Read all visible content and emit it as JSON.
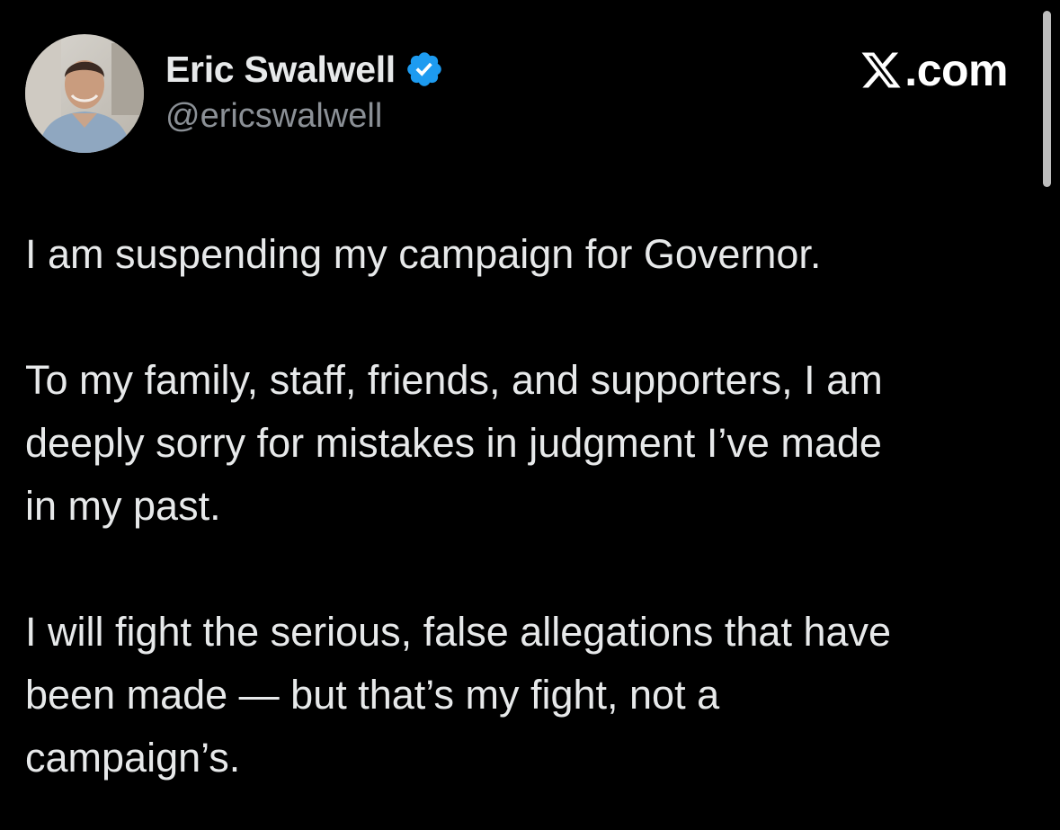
{
  "author": {
    "display_name": "Eric Swalwell",
    "handle": "@ericswalwell",
    "verified_icon": "verified-badge-icon",
    "avatar_icon": "profile-photo"
  },
  "brand": {
    "icon": "x-logo-icon",
    "label": ".com"
  },
  "colors": {
    "background": "#000000",
    "text": "#e7e9ea",
    "secondary_text": "#8b9096",
    "verified": "#1d9bf0"
  },
  "tweet": {
    "paragraphs": [
      "I am suspending my campaign for Governor.",
      "To my family, staff, friends, and supporters, I am\ndeeply sorry for mistakes in judgment I’ve made\nin my past.",
      "I will fight the serious, false allegations that have\nbeen made — but that’s my fight, not a\ncampaign’s."
    ]
  }
}
